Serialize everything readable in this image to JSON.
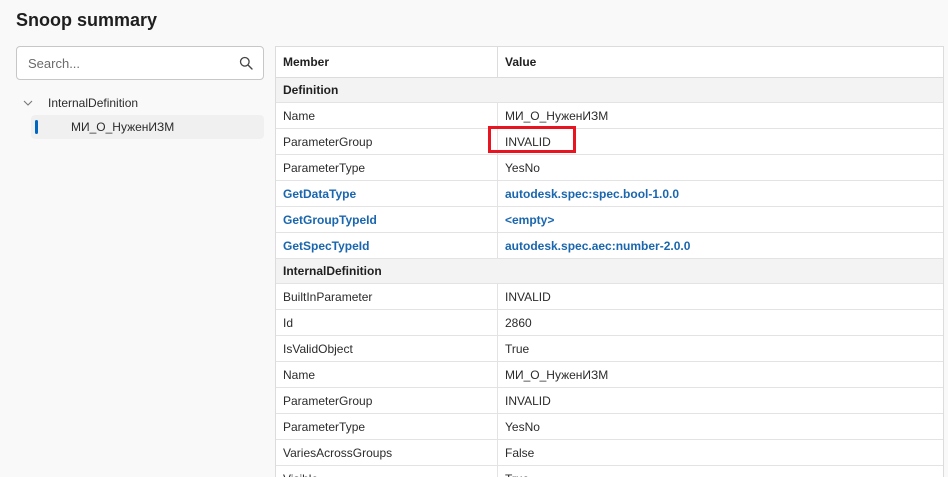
{
  "title": "Snoop summary",
  "search": {
    "placeholder": "Search..."
  },
  "tree": {
    "root_label": "InternalDefinition",
    "child_label": "МИ_О_НуженИЗМ"
  },
  "grid": {
    "columns": [
      "Member",
      "Value"
    ],
    "groups": [
      {
        "name": "Definition",
        "rows": [
          {
            "member": "Name",
            "value": "МИ_О_НуженИЗМ"
          },
          {
            "member": "ParameterGroup",
            "value": "INVALID"
          },
          {
            "member": "ParameterType",
            "value": "YesNo"
          },
          {
            "member": "GetDataType",
            "value": "autodesk.spec:spec.bool-1.0.0"
          },
          {
            "member": "GetGroupTypeId",
            "value": "<empty>"
          },
          {
            "member": "GetSpecTypeId",
            "value": "autodesk.spec.aec:number-2.0.0"
          }
        ]
      },
      {
        "name": "InternalDefinition",
        "rows": [
          {
            "member": "BuiltInParameter",
            "value": "INVALID"
          },
          {
            "member": "Id",
            "value": "2860"
          },
          {
            "member": "IsValidObject",
            "value": "True"
          },
          {
            "member": "Name",
            "value": "МИ_О_НуженИЗМ"
          },
          {
            "member": "ParameterGroup",
            "value": "INVALID"
          },
          {
            "member": "ParameterType",
            "value": "YesNo"
          },
          {
            "member": "VariesAcrossGroups",
            "value": "False"
          },
          {
            "member": "Visible",
            "value": "True"
          }
        ]
      }
    ]
  },
  "colors": {
    "accent": "#0067c0",
    "link": "#1a66ae",
    "highlight": "#e8141f"
  }
}
